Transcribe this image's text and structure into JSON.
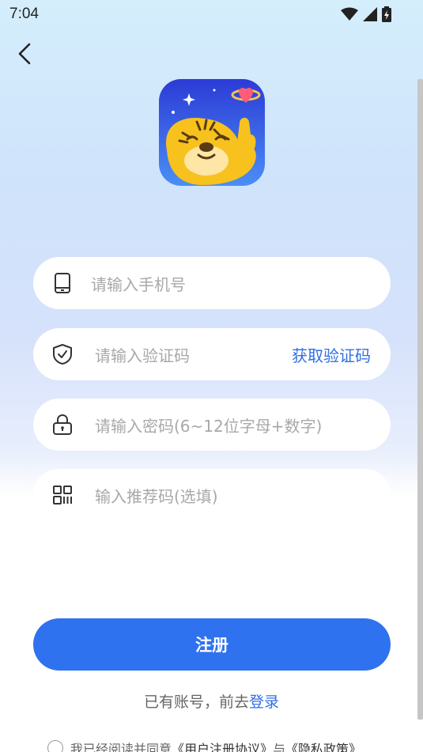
{
  "status_bar": {
    "time": "7:04"
  },
  "form": {
    "phone_placeholder": "请输入手机号",
    "code_placeholder": "请输入验证码",
    "get_code_label": "获取验证码",
    "password_placeholder": "请输入密码(6~12位字母+数字)",
    "referral_placeholder": "输入推荐码(选填)"
  },
  "register_label": "注册",
  "login_prompt": "已有账号，前去",
  "login_link": "登录",
  "agreement": {
    "prefix": "我已经阅读并同意",
    "user_agreement": "《用户注册协议》",
    "conjunction": "与",
    "privacy_policy": "《隐私政策》"
  },
  "icons": [
    "back-arrow-icon",
    "wifi-icon",
    "signal-icon",
    "battery-icon",
    "phone-icon",
    "shield-check-icon",
    "lock-icon",
    "qr-code-icon"
  ]
}
